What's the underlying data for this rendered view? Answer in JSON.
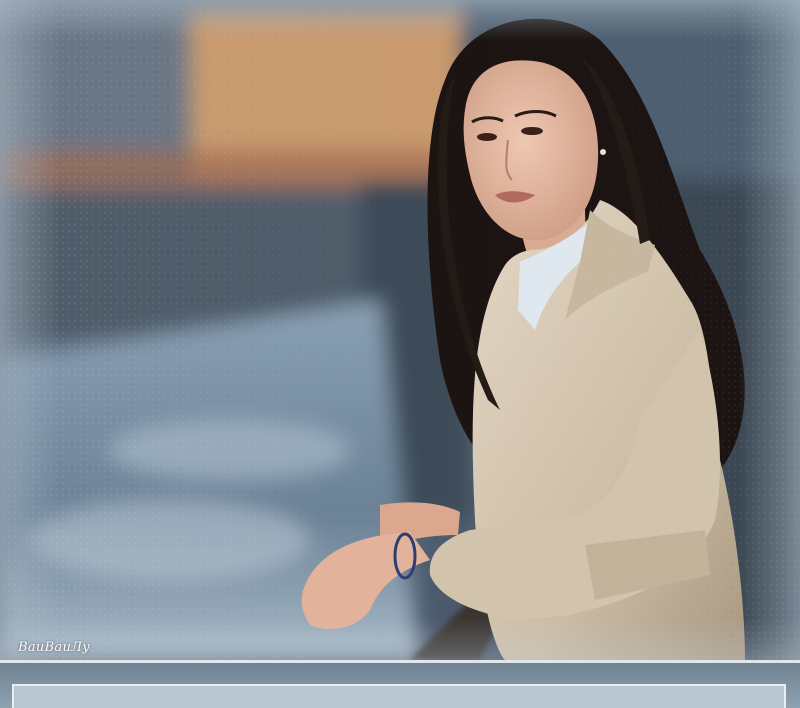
{
  "image": {
    "signature": "BaиBaиЛу"
  },
  "palette": {
    "sky": "#5d6a77",
    "building": "#c99a6e",
    "water": "#7f95a8",
    "hair": "#1b1412",
    "skin": "#e2b8a2",
    "coat": "#d6c7b1",
    "coat_shadow": "#b7a68e",
    "shirt": "#dfe7ef",
    "frame_light": "#dfe7ec",
    "frame_panel": "#b7c6d1"
  }
}
